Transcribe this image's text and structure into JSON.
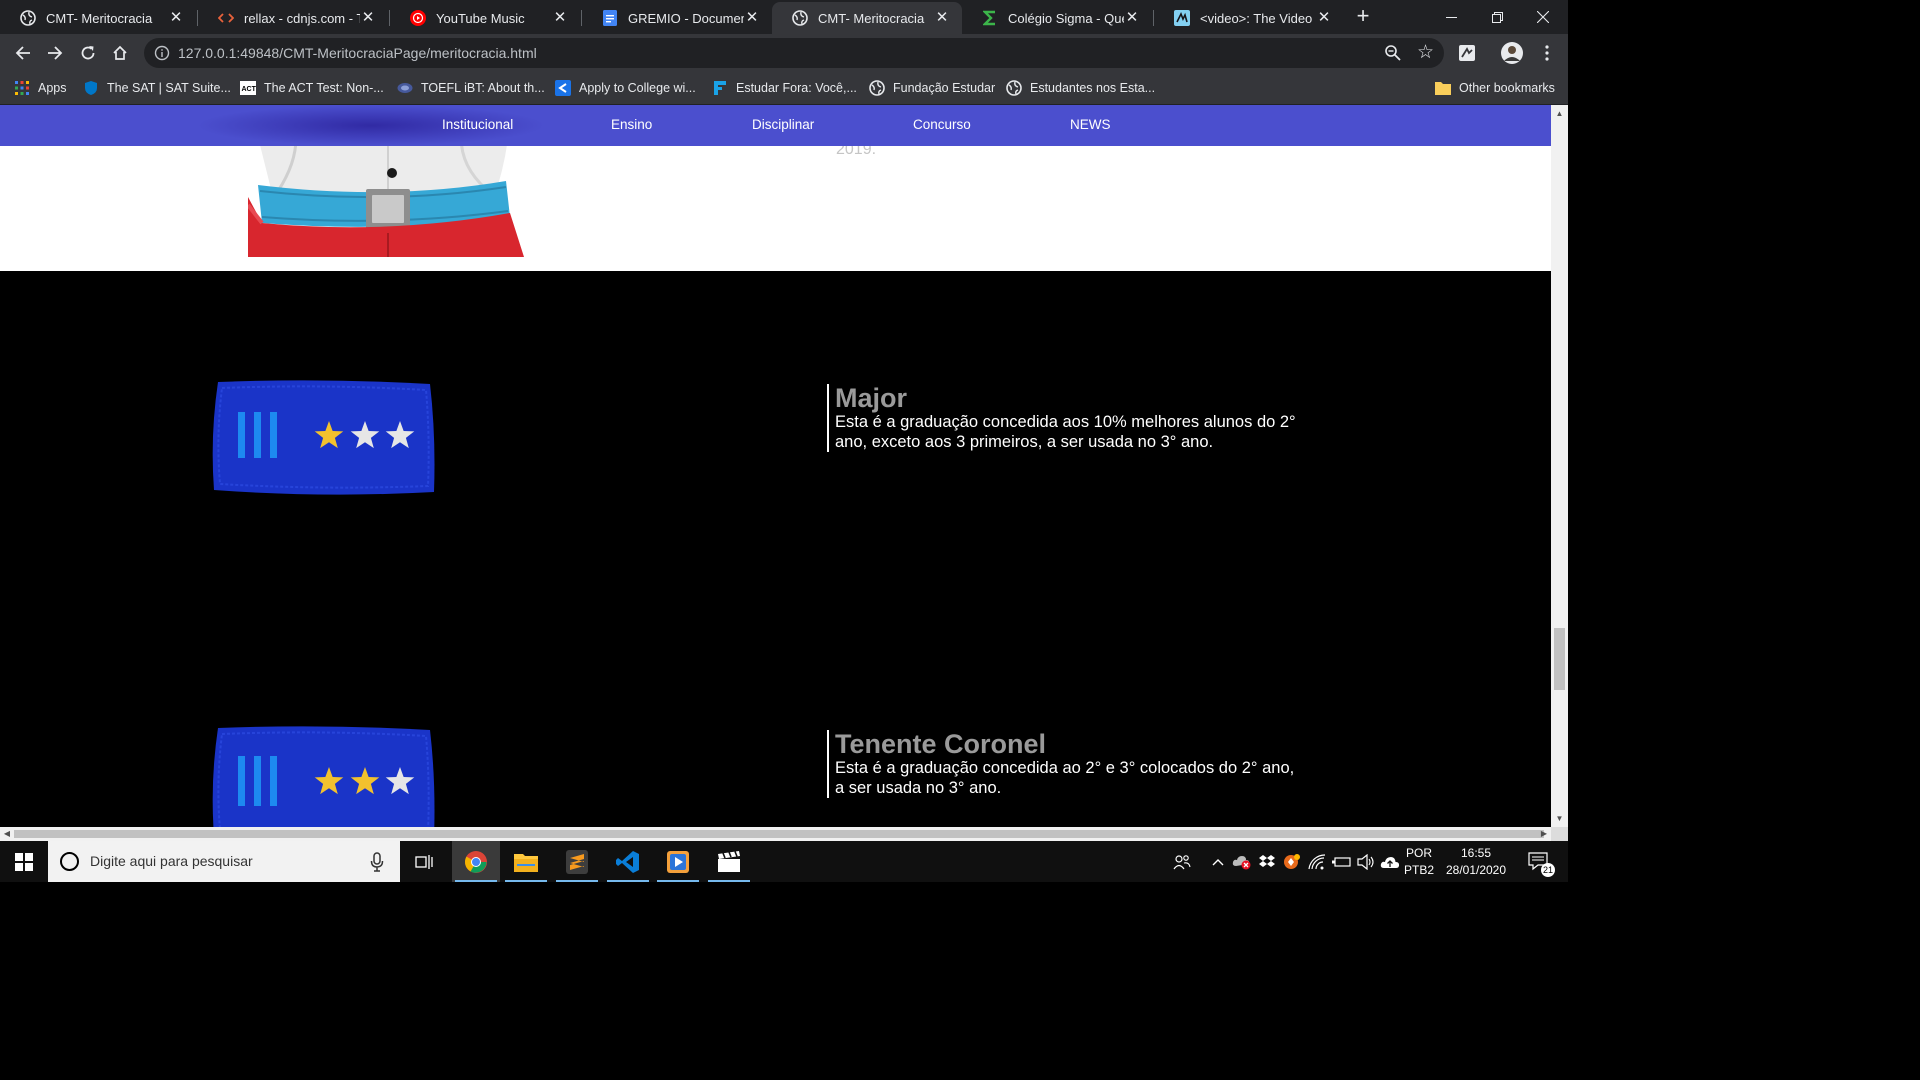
{
  "browser": {
    "tabs": [
      {
        "title": "CMT- Meritocracia",
        "icon": "globe-icon",
        "active": false
      },
      {
        "title": "rellax - cdnjs.com - The",
        "icon": "code-icon",
        "active": false
      },
      {
        "title": "YouTube Music",
        "icon": "youtube-music-icon",
        "active": false
      },
      {
        "title": "GREMIO - Documentos",
        "icon": "docs-icon",
        "active": false
      },
      {
        "title": "CMT- Meritocracia",
        "icon": "globe-icon",
        "active": true
      },
      {
        "title": "Colégio Sigma - Quem",
        "icon": "sigma-icon",
        "active": false
      },
      {
        "title": "<video>: The Video Em",
        "icon": "mdn-icon",
        "active": false
      }
    ],
    "url": "127.0.0.1:49848/CMT-MeritocraciaPage/meritocracia.html",
    "bookmarks": [
      {
        "label": "Apps",
        "icon": "apps-grid-icon"
      },
      {
        "label": "The SAT | SAT Suite...",
        "icon": "shield-icon"
      },
      {
        "label": "The ACT Test: Non-...",
        "icon": "act-icon"
      },
      {
        "label": "TOEFL iBT: About th...",
        "icon": "toefl-icon"
      },
      {
        "label": "Apply to College wi...",
        "icon": "common-app-icon"
      },
      {
        "label": "Estudar Fora: Você,...",
        "icon": "estudar-fora-icon"
      },
      {
        "label": "Fundação Estudar",
        "icon": "globe-icon"
      },
      {
        "label": "Estudantes nos Esta...",
        "icon": "globe-icon"
      }
    ],
    "other_bookmarks": "Other bookmarks"
  },
  "page": {
    "nav": [
      "Institucional",
      "Ensino",
      "Disciplinar",
      "Concurso",
      "NEWS"
    ],
    "year_fragment": "2019.",
    "ranks": [
      {
        "title": "Major",
        "description": "Esta é a graduação concedida aos 10% melhores alunos do 2° ano, exceto aos 3 primeiros, a ser usada no 3° ano.",
        "gold_stars": 1
      },
      {
        "title": "Tenente Coronel",
        "description": "Esta é a graduação concedida ao 2° e 3° colocados do 2° ano, a ser usada no 3° ano.",
        "gold_stars": 2
      }
    ]
  },
  "taskbar": {
    "search_placeholder": "Digite aqui para pesquisar",
    "language": "POR",
    "layout": "PTB2",
    "time": "16:55",
    "date": "28/01/2020",
    "notifications": "21"
  }
}
